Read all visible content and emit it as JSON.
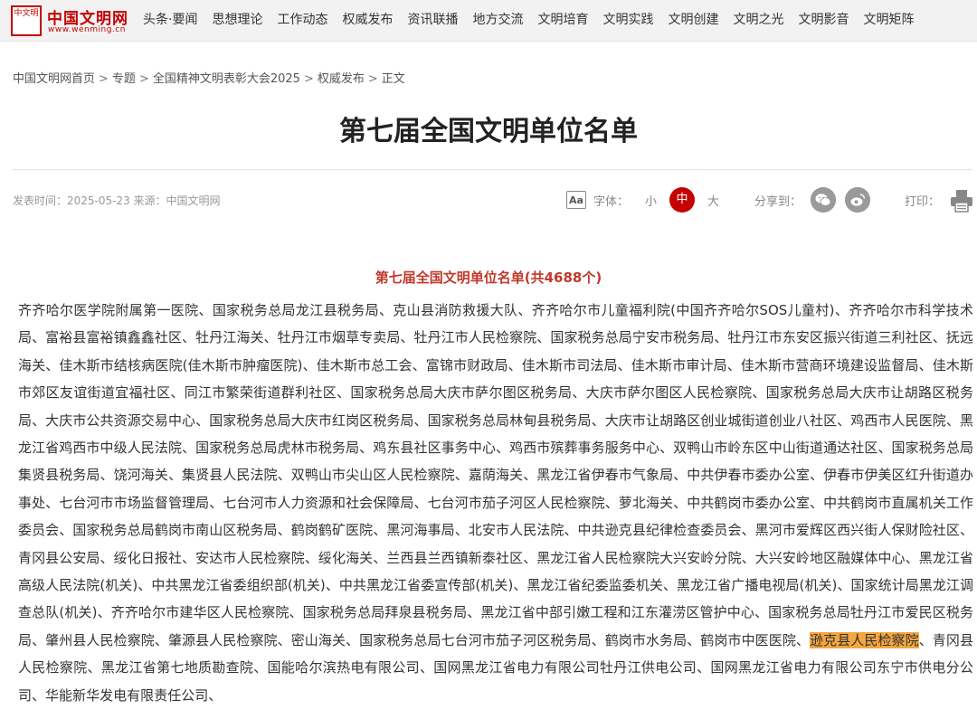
{
  "logo": {
    "seal": "中文明",
    "name": "中国文明网",
    "url": "www.wenming.cn"
  },
  "nav": [
    "头条·要闻",
    "思想理论",
    "工作动态",
    "权威发布",
    "资讯联播",
    "地方交流",
    "文明培育",
    "文明实践",
    "文明创建",
    "文明之光",
    "文明影音",
    "文明矩阵"
  ],
  "breadcrumb": [
    "中国文明网首页",
    "专题",
    "全国精神文明表彰大会2025",
    "权威发布",
    "正文"
  ],
  "breadcrumb_sep": ">",
  "title": "第七届全国文明单位名单",
  "meta": "发表时间：2025-05-23 来源：中国文明网",
  "font": {
    "icon": "Aa",
    "label": "字体：",
    "small": "小",
    "medium": "中",
    "large": "大"
  },
  "share": {
    "label": "分享到：",
    "icons": [
      "wechat-icon",
      "weibo-icon"
    ]
  },
  "print": {
    "label": "打印：",
    "icon": "printer-icon"
  },
  "subtitle": "第七届全国文明单位名单(共4688个)",
  "body": {
    "before": "齐齐哈尔医学院附属第一医院、国家税务总局龙江县税务局、克山县消防救援大队、齐齐哈尔市儿童福利院(中国齐齐哈尔SOS儿童村)、齐齐哈尔市科学技术局、富裕县富裕镇鑫鑫社区、牡丹江海关、牡丹江市烟草专卖局、牡丹江市人民检察院、国家税务总局宁安市税务局、牡丹江市东安区振兴街道三利社区、抚远海关、佳木斯市结核病医院(佳木斯市肿瘤医院)、佳木斯市总工会、富锦市财政局、佳木斯市司法局、佳木斯市审计局、佳木斯市营商环境建设监督局、佳木斯市郊区友谊街道宜福社区、同江市繁荣街道群利社区、国家税务总局大庆市萨尔图区税务局、大庆市萨尔图区人民检察院、国家税务总局大庆市让胡路区税务局、大庆市公共资源交易中心、国家税务总局大庆市红岗区税务局、国家税务总局林甸县税务局、大庆市让胡路区创业城街道创业八社区、鸡西市人民医院、黑龙江省鸡西市中级人民法院、国家税务总局虎林市税务局、鸡东县社区事务中心、鸡西市殡葬事务服务中心、双鸭山市岭东区中山街道通达社区、国家税务总局集贤县税务局、饶河海关、集贤县人民法院、双鸭山市尖山区人民检察院、嘉荫海关、黑龙江省伊春市气象局、中共伊春市委办公室、伊春市伊美区红升街道办事处、七台河市市场监督管理局、七台河市人力资源和社会保障局、七台河市茄子河区人民检察院、萝北海关、中共鹤岗市委办公室、中共鹤岗市直属机关工作委员会、国家税务总局鹤岗市南山区税务局、鹤岗鹤矿医院、黑河海事局、北安市人民法院、中共逊克县纪律检查委员会、黑河市爱辉区西兴街人保财险社区、青冈县公安局、绥化日报社、安达市人民检察院、绥化海关、兰西县兰西镇新泰社区、黑龙江省人民检察院大兴安岭分院、大兴安岭地区融媒体中心、黑龙江省高级人民法院(机关)、中共黑龙江省委组织部(机关)、中共黑龙江省委宣传部(机关)、黑龙江省纪委监委机关、黑龙江省广播电视局(机关)、国家统计局黑龙江调查总队(机关)、齐齐哈尔市建华区人民检察院、国家税务总局拜泉县税务局、黑龙江省中部引嫩工程和江东灌涝区管护中心、国家税务总局牡丹江市爱民区税务局、肇州县人民检察院、肇源县人民检察院、密山海关、国家税务总局七台河市茄子河区税务局、鹤岗市水务局、鹤岗市中医医院、",
    "highlight": "逊克县人民检察院",
    "after": "、青冈县人民检察院、黑龙江省第七地质勘查院、国能哈尔滨热电有限公司、国网黑龙江省电力有限公司牡丹江供电公司、国网黑龙江省电力有限公司东宁市供电分公司、华能新华发电有限责任公司、"
  }
}
